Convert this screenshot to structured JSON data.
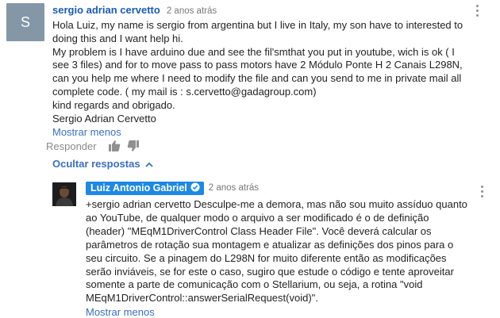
{
  "comment": {
    "avatar_letter": "S",
    "author": "sergio adrian cervetto",
    "time": "2 anos atrás",
    "lines": [
      "Hola Luiz, my name is sergio from argentina but I live in Italy, my son have to interested to",
      "doing this and I want help hi.",
      "My problem is I have arduino due and see the fil'smthat you put in youtube, wich is ok ( I",
      "see 3 files) and for to move pass to pass motors have 2 Módulo Ponte H 2 Canais L298N,",
      "can you help me where I need to modify the file and can you send to me in private mail all",
      "complete code. ( my mail is : s.cervetto@gadagroup.com)",
      "kind regards and obrigado.",
      "Sergio Adrian Cervetto"
    ],
    "show_less": "Mostrar menos",
    "reply_label": "Responder",
    "like_icon": "thumb-up-icon",
    "dislike_icon": "thumb-down-icon",
    "hide_replies": "Ocultar respostas"
  },
  "reply": {
    "author": "Luiz Antonio Gabriel",
    "verified_icon": "check-circle-icon",
    "time": "2 anos atrás",
    "lines": [
      "+sergio adrian cervetto Desculpe-me a demora, mas não sou muito assíduo quanto",
      "ao YouTube, de qualquer modo o arquivo a ser modificado é o de definição",
      "(header) \"MEqM1DriverControl Class Header File\". Você deverá calcular os",
      "parâmetros de rotação sua montagem e atualizar as definições dos pinos para o",
      "seu circuito. Se a pinagem do L298N for muito diferente então as modificações",
      "serão inviáveis, se for este o caso, sugiro que estude o código e tente aproveitar",
      "somente a parte de comunicação com o Stellarium, ou seja, a rotina \"void",
      "MEqM1DriverControl::answerSerialRequest(void)\"."
    ],
    "show_less": "Mostrar menos"
  },
  "colors": {
    "link": "#3a6fbf",
    "author": "#1a5bb5",
    "chip": "#1e88e5",
    "avatar_bg": "#8497a6"
  }
}
